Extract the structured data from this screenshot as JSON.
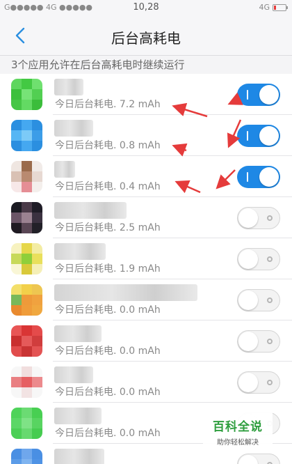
{
  "status_bar": {
    "left": "G●●●●● 4G ●●●●●",
    "time": "10,28",
    "right": "4G",
    "battery_level": 0.2
  },
  "header": {
    "back_icon": "chevron-left-icon",
    "title": "后台高耗电"
  },
  "subheader": "3个应用允许在后台高耗电时继续运行",
  "colors": {
    "accent": "#1e88e5",
    "annotation": "#e53b3b"
  },
  "apps": [
    {
      "usage": "今日后台耗电. 7.2 mAh",
      "enabled": true,
      "icon_colors": [
        "#5ed65e",
        "#43c943",
        "#6fe06f",
        "#3cc03c",
        "#77e377",
        "#52cf52",
        "#46c646",
        "#63da63",
        "#3bbd3b"
      ]
    },
    {
      "usage": "今日后台耗电. 0.8 mAh",
      "enabled": true,
      "icon_colors": [
        "#2b8fe0",
        "#45a8f0",
        "#2b8fe0",
        "#56b6f4",
        "#7ccaf7",
        "#3c9de8",
        "#2b8fe0",
        "#45a8f0",
        "#2b8fe0"
      ]
    },
    {
      "usage": "今日后台耗电. 0.4 mAh",
      "enabled": true,
      "icon_colors": [
        "#efe6e1",
        "#9a6b4c",
        "#f1ebe8",
        "#d9c1b4",
        "#b98a70",
        "#e7d9d2",
        "#f7e8e8",
        "#e58e95",
        "#f4efec"
      ]
    },
    {
      "usage": "今日后台耗电. 2.5 mAh",
      "enabled": false,
      "icon_colors": [
        "#1a1a22",
        "#4a3a48",
        "#1f1c26",
        "#6b5567",
        "#9b8291",
        "#3b3140",
        "#1f1a22",
        "#5a4755",
        "#222028"
      ]
    },
    {
      "usage": "今日后台耗电. 1.9 mAh",
      "enabled": false,
      "icon_colors": [
        "#f7f2c0",
        "#e6d74a",
        "#f3eca3",
        "#c7d95a",
        "#8fcf3a",
        "#e9e05b",
        "#f9f6d6",
        "#d9c93a",
        "#f5efb6"
      ]
    },
    {
      "usage": "今日后台耗电. 0.0 mAh",
      "enabled": false,
      "icon_colors": [
        "#f3df6a",
        "#f2d04a",
        "#eec651",
        "#79b85a",
        "#ee9a3a",
        "#f0a23f",
        "#e98a2f",
        "#ef9c3a",
        "#f0a840"
      ]
    },
    {
      "usage": "今日后台耗电. 0.0 mAh",
      "enabled": false,
      "icon_colors": [
        "#e85555",
        "#d93535",
        "#e44b4b",
        "#c92f2f",
        "#e55a5a",
        "#d03d3d",
        "#e14c4c",
        "#c93434",
        "#e35353"
      ]
    },
    {
      "usage": "今日后台耗电. 0.0 mAh",
      "enabled": false,
      "icon_colors": [
        "#f7f7f7",
        "#f1dede",
        "#f7f7f7",
        "#e97f82",
        "#e65f62",
        "#ec8a8d",
        "#f7f7f7",
        "#f2e3e3",
        "#f7f7f7"
      ]
    },
    {
      "usage": "今日后台耗电. 0.0 mAh",
      "enabled": false,
      "icon_colors": [
        "#4fd35a",
        "#6bdb73",
        "#48cf52",
        "#5cd767",
        "#7fe286",
        "#58d461",
        "#4ccf56",
        "#67d96f",
        "#46cc50"
      ]
    },
    {
      "usage": "",
      "enabled": false,
      "icon_colors": [
        "#4a8fe3",
        "#6fa7ec",
        "#4a8fe3",
        "#5b9ce8",
        "#7fb4f0",
        "#4f93e5",
        "#4a8fe3",
        "#6fa7ec",
        "#4a8fe3"
      ]
    }
  ],
  "watermark": {
    "title": "百科全说",
    "subtitle": "助你轻松解决"
  }
}
